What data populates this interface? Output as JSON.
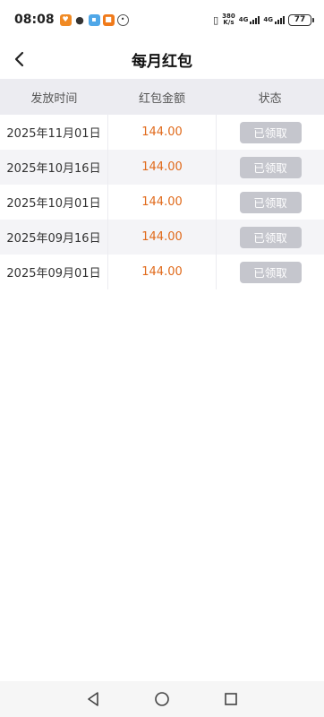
{
  "status_bar": {
    "time": "08:08",
    "speed_top": "380",
    "speed_bottom": "K/s",
    "net1": "4G",
    "net2": "4G",
    "battery": "77"
  },
  "header": {
    "title": "每月红包",
    "back_icon": "chevron-left-icon"
  },
  "table": {
    "columns": [
      "发放时间",
      "红包金额",
      "状态"
    ],
    "rows": [
      {
        "date": "2025年11月01日",
        "amount": "144.00",
        "status": "已领取"
      },
      {
        "date": "2025年10月16日",
        "amount": "144.00",
        "status": "已领取"
      },
      {
        "date": "2025年10月01日",
        "amount": "144.00",
        "status": "已领取"
      },
      {
        "date": "2025年09月16日",
        "amount": "144.00",
        "status": "已领取"
      },
      {
        "date": "2025年09月01日",
        "amount": "144.00",
        "status": "已领取"
      }
    ]
  },
  "colors": {
    "amount": "#e06a1b",
    "status_button_bg": "#c5c6cd",
    "header_bg": "#ececf1",
    "alt_row_bg": "#f4f4f7"
  },
  "system_nav": {
    "back_icon": "triangle-back-icon",
    "home_icon": "circle-home-icon",
    "recents_icon": "square-recents-icon"
  }
}
